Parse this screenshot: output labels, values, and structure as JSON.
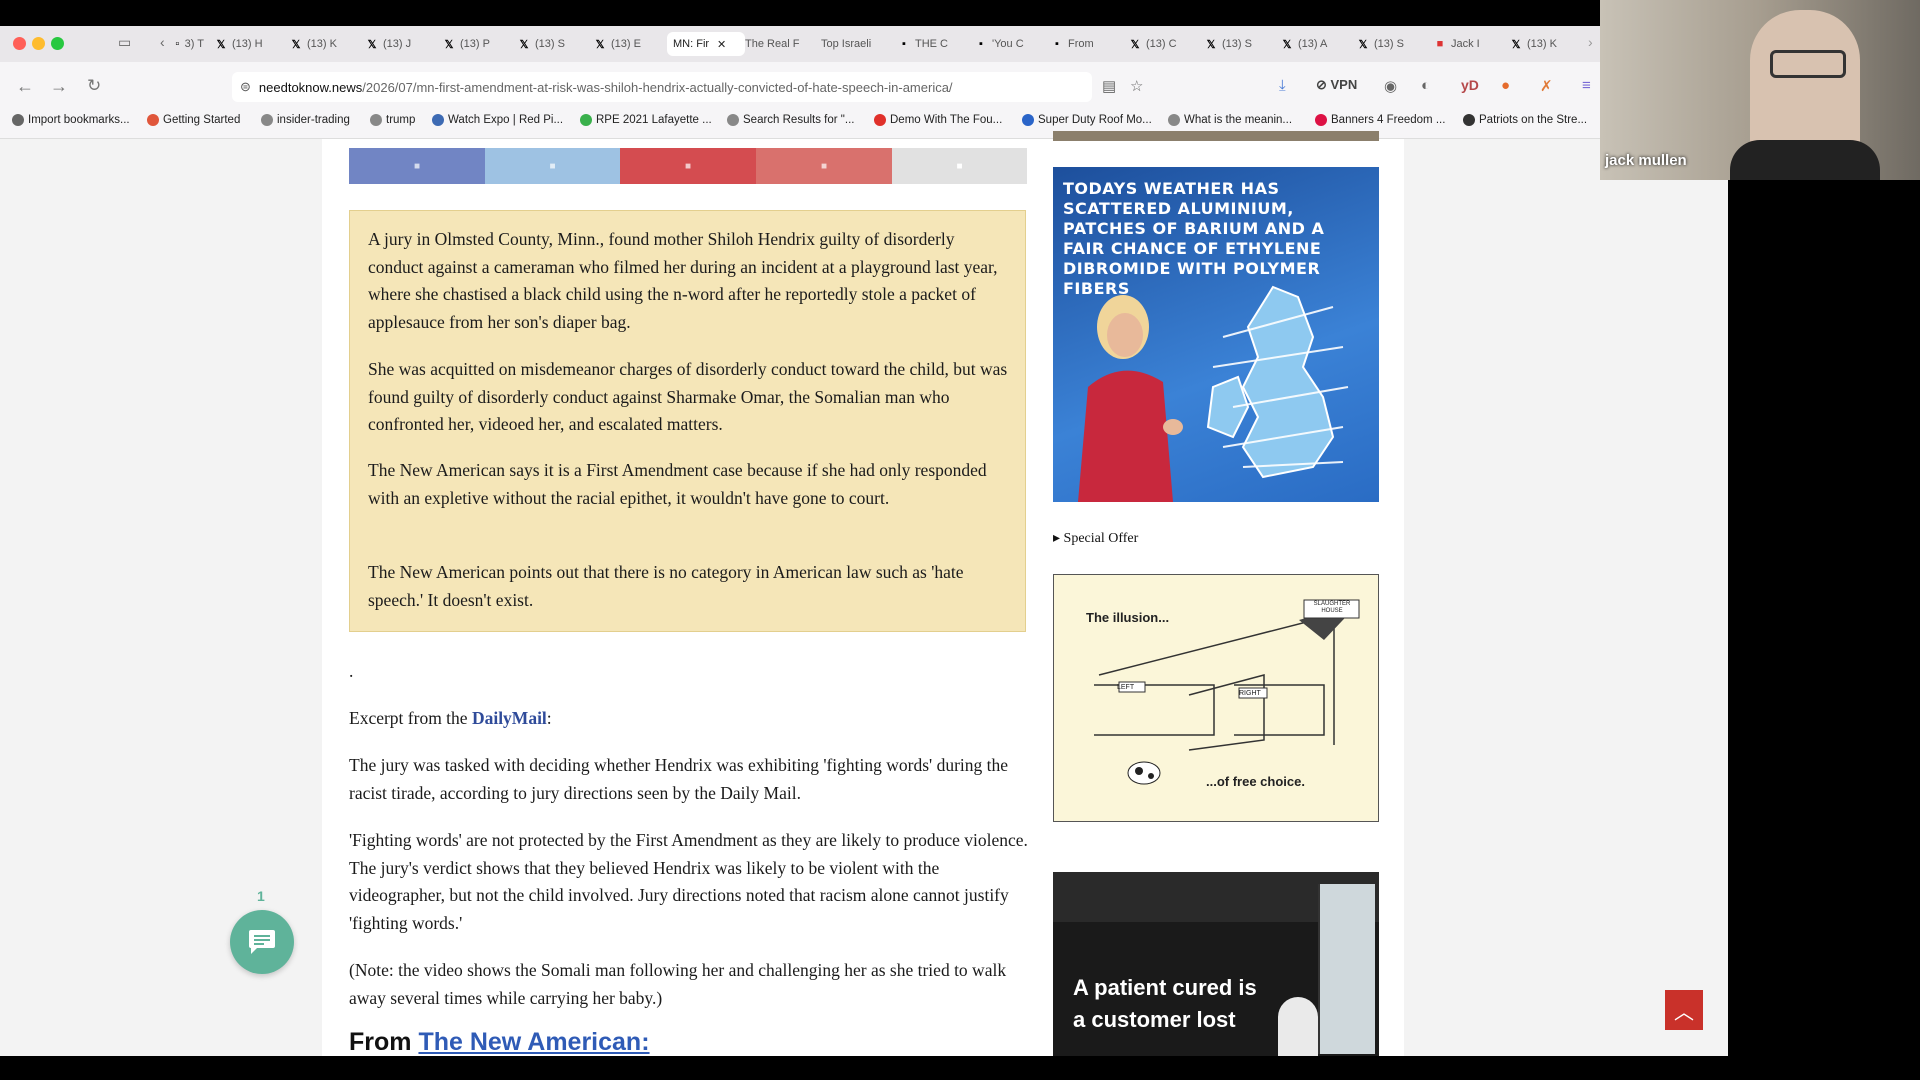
{
  "tabs": [
    {
      "label": "3) T",
      "icon": "tab-icon"
    },
    {
      "label": "(13) H",
      "icon": "x-icon"
    },
    {
      "label": "(13) K",
      "icon": "x-icon"
    },
    {
      "label": "(13) J",
      "icon": "x-icon"
    },
    {
      "label": "(13) P",
      "icon": "x-icon"
    },
    {
      "label": "(13) S",
      "icon": "x-icon"
    },
    {
      "label": "(13) E",
      "icon": "x-icon"
    },
    {
      "label": "MN: Fir",
      "icon": "",
      "active": true
    },
    {
      "label": "The Real F",
      "icon": ""
    },
    {
      "label": "Top Israeli",
      "icon": ""
    },
    {
      "label": "THE C",
      "icon": "tgr-icon"
    },
    {
      "label": "'You C",
      "icon": "tgr-icon"
    },
    {
      "label": "From",
      "icon": "tgr-icon"
    },
    {
      "label": "(13) C",
      "icon": "x-icon"
    },
    {
      "label": "(13) S",
      "icon": "x-icon"
    },
    {
      "label": "(13) A",
      "icon": "x-icon"
    },
    {
      "label": "(13) S",
      "icon": "x-icon"
    },
    {
      "label": "Jack I",
      "icon": "jf-icon"
    },
    {
      "label": "(13) K",
      "icon": "x-icon"
    }
  ],
  "url": {
    "host": "needtoknow.news",
    "path": "/2026/07/mn-first-amendment-at-risk-was-shiloh-hendrix-actually-convicted-of-hate-speech-in-america/"
  },
  "vpn_label": "VPN",
  "bookmarks": [
    "Import bookmarks...",
    "Getting Started",
    "insider-trading",
    "trump",
    "Watch Expo | Red Pi...",
    "RPE 2021 Lafayette ...",
    "Search Results for \"...",
    "Demo With The Fou...",
    "Super Duty Roof Mo...",
    "What is the meanin...",
    "Banners 4 Freedom ...",
    "Patriots on the Stre..."
  ],
  "quote_paragraphs": [
    "A jury in Olmsted County, Minn., found mother Shiloh Hendrix guilty of disorderly conduct against a cameraman who filmed her during an incident at a playground last year, where she chastised a black child using the n-word after he reportedly stole a packet of applesauce from her son's diaper bag.",
    "She was acquitted on misdemeanor charges of disorderly conduct toward the child, but was found guilty of disorderly conduct against Sharmake Omar, the Somalian man who confronted her, videoed her, and escalated matters.",
    "The New American says it is a First Amendment case because if she had only responded with an expletive without the racial epithet, it wouldn't have gone to court.",
    "The New American points out that there is no category in American law such as 'hate speech.' It doesn't exist."
  ],
  "dot": ".",
  "excerpt": {
    "prefix": "Excerpt from the ",
    "link": "DailyMail",
    "suffix": ":"
  },
  "body_paragraphs": [
    "The jury was tasked with deciding whether Hendrix was exhibiting 'fighting words' during the racist tirade, according to jury directions seen by the Daily Mail.",
    "'Fighting words' are not protected by the First Amendment as they are likely to produce violence. The jury's verdict shows that they believed Hendrix was likely to be violent with the videographer, but not the child involved. Jury directions noted that racism alone cannot justify 'fighting words.'",
    "(Note: the video shows the Somali man following her and challenging her as she tried to walk away several times while carrying her baby.)"
  ],
  "from_heading": {
    "prefix": "From ",
    "link": "The New American:"
  },
  "sidebar": {
    "ad1_text": "TODAYS WEATHER HAS SCATTERED ALUMINIUM, PATCHES OF BARIUM AND A FAIR CHANCE OF ETHYLENE DIBROMIDE WITH POLYMER FIBERS",
    "special_offer": "▸ Special Offer",
    "ad2": {
      "illusion": "The illusion...",
      "left": "LEFT",
      "right": "RIGHT",
      "slaughter": "SLAUGHTER HOUSE",
      "caption": "...of free choice."
    },
    "ad3_line1": "A patient cured is",
    "ad3_line2": "a customer lost"
  },
  "chat_count": "1",
  "video_name": "jack mullen",
  "colors": {
    "quote_bg": "#f5e6b8",
    "link": "#2f4b9a",
    "top_button": "#c9312a",
    "chat_button": "#5fb39a"
  }
}
